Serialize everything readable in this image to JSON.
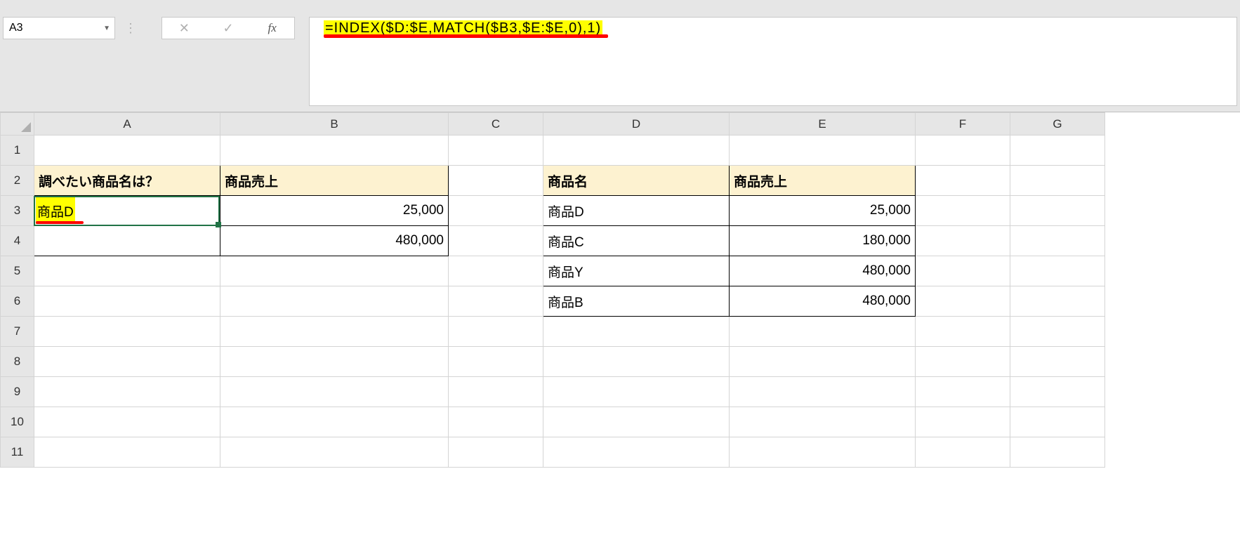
{
  "name_box": {
    "value": "A3"
  },
  "formula_bar": {
    "cancel_tooltip": "Cancel",
    "enter_tooltip": "Enter",
    "fx_label": "fx",
    "formula": "=INDEX($D:$E,MATCH($B3,$E:$E,0),1)"
  },
  "columns": [
    "A",
    "B",
    "C",
    "D",
    "E",
    "F",
    "G"
  ],
  "row_numbers": [
    "1",
    "2",
    "3",
    "4",
    "5",
    "6",
    "7",
    "8",
    "9",
    "10",
    "11"
  ],
  "left_table": {
    "headers": {
      "a": "調べたい商品名は？",
      "b": "商品売上"
    },
    "rows": [
      {
        "a": "商品D",
        "b": "25,000"
      },
      {
        "a": "",
        "b": "480,000"
      }
    ]
  },
  "right_table": {
    "headers": {
      "d": "商品名",
      "e": "商品売上"
    },
    "rows": [
      {
        "d": "商品D",
        "e": "25,000"
      },
      {
        "d": "商品C",
        "e": "180,000"
      },
      {
        "d": "商品Y",
        "e": "480,000"
      },
      {
        "d": "商品B",
        "e": "480,000"
      }
    ]
  },
  "colors": {
    "header_fill": "#fdf2d0",
    "highlight": "#ffff00",
    "underline": "#ff0000",
    "selection": "#217346"
  }
}
